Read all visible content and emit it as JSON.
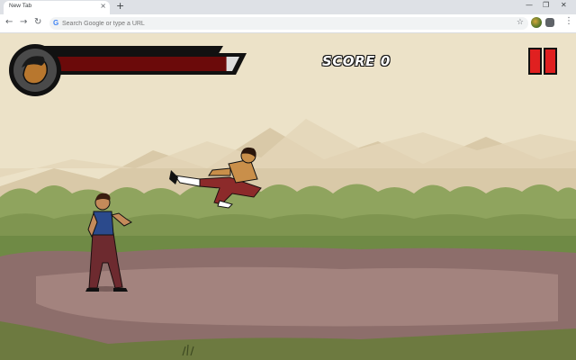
{
  "browser": {
    "tab_title": "New Tab",
    "tab_close": "×",
    "new_tab": "+",
    "omnibox_placeholder": "Search Google or type a URL",
    "window_controls": [
      "—",
      "❐",
      "✕"
    ],
    "nav": {
      "back": "←",
      "forward": "→",
      "reload": "↻"
    }
  },
  "game": {
    "score_label": "SCORE",
    "score_value": "0",
    "health": 0.93,
    "pause_icon": "pause-icon",
    "colors": {
      "health_fill": "#6b0a0a",
      "pause": "#e02020",
      "sky": "#ece2c8",
      "ground": "#8d6e6b",
      "bushes": "#8fa45e"
    }
  }
}
